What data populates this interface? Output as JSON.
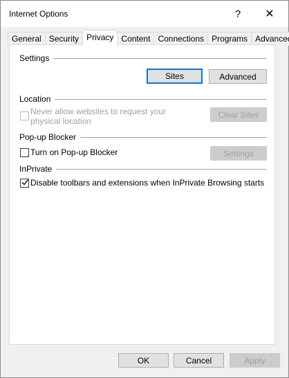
{
  "window": {
    "title": "Internet Options"
  },
  "titlebar": {
    "help_glyph": "?",
    "close_glyph": "✕"
  },
  "tabs": [
    {
      "label": "General"
    },
    {
      "label": "Security"
    },
    {
      "label": "Privacy",
      "active": true
    },
    {
      "label": "Content"
    },
    {
      "label": "Connections"
    },
    {
      "label": "Programs"
    },
    {
      "label": "Advanced"
    }
  ],
  "settings": {
    "heading": "Settings",
    "sites_button": "Sites",
    "advanced_button": "Advanced"
  },
  "location": {
    "heading": "Location",
    "checkbox_label_line1": "Never allow websites to request your",
    "checkbox_label_line2": "physical location",
    "checked": false,
    "enabled": false,
    "clear_sites_button": "Clear Sites"
  },
  "popup": {
    "heading": "Pop-up Blocker",
    "checkbox_label": "Turn on Pop-up Blocker",
    "checked": false,
    "settings_button": "Settings"
  },
  "inprivate": {
    "heading": "InPrivate",
    "checkbox_label": "Disable toolbars and extensions when InPrivate Browsing starts",
    "checked": true
  },
  "footer": {
    "ok_button": "OK",
    "cancel_button": "Cancel",
    "apply_button": "Apply"
  },
  "colors": {
    "accent": "#0078d7",
    "disabled_text": "#a0a0a0"
  }
}
